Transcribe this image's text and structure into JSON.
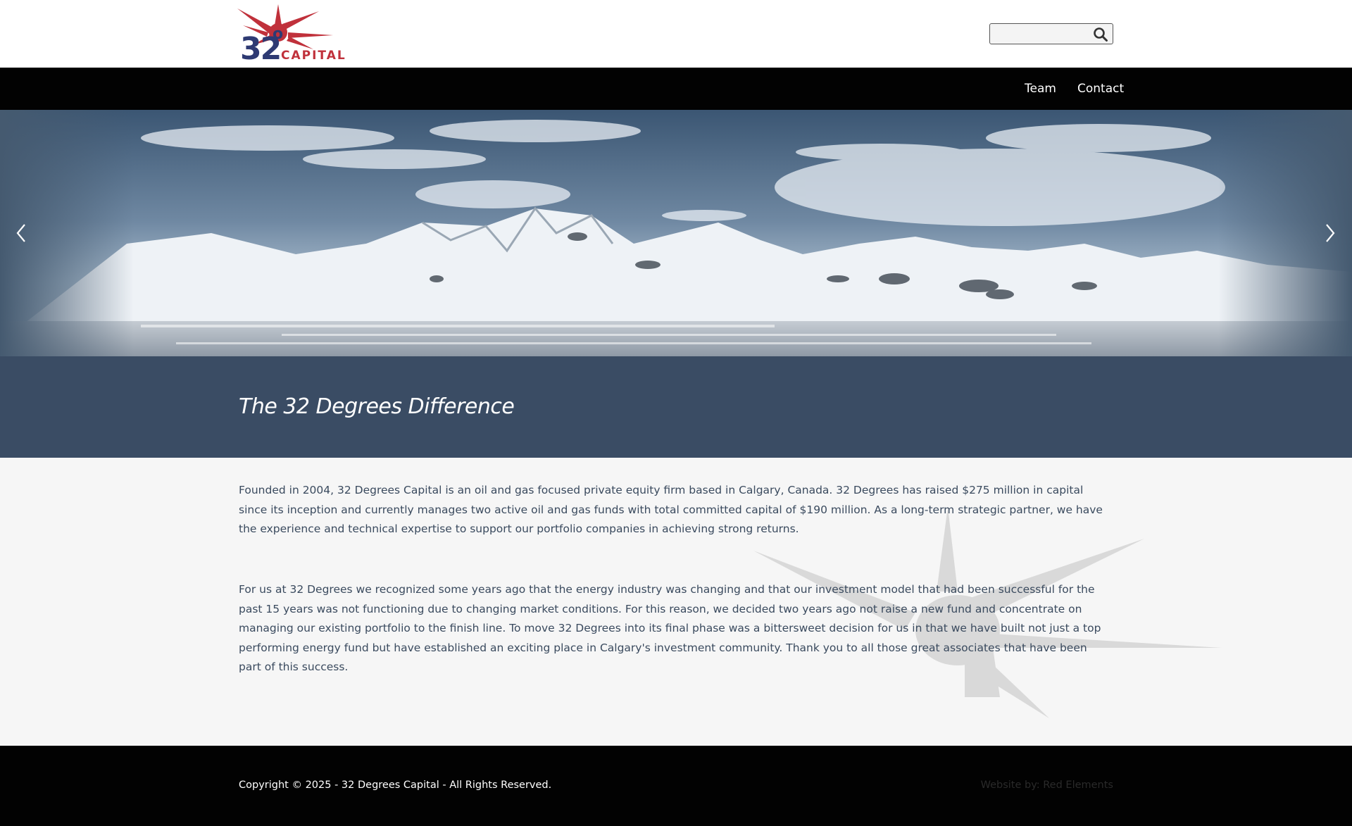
{
  "brand": {
    "logo_number": "32",
    "logo_degree": "o",
    "logo_word": "CAPITAL",
    "colors": {
      "navy": "#2e3a73",
      "red": "#c0313b"
    }
  },
  "search": {
    "placeholder": "",
    "value": "",
    "icon": "search-icon"
  },
  "nav": {
    "items": [
      {
        "label": "Team"
      },
      {
        "label": "Contact"
      }
    ]
  },
  "hero": {
    "prev_icon": "chevron-left-icon",
    "next_icon": "chevron-right-icon"
  },
  "section": {
    "title": "The 32 Degrees Difference"
  },
  "content": {
    "paragraphs": [
      "Founded in 2004, 32 Degrees Capital is an oil and gas focused private equity firm based in Calgary, Canada. 32 Degrees has raised $275 million in capital since its inception and currently manages two active oil and gas funds with total committed capital of $190 million. As a long-term strategic partner, we have the experience and technical expertise to support our portfolio companies in achieving strong returns.",
      "For us at 32 Degrees we recognized some years ago that the energy industry was changing and that our investment model that had been successful for the past 15 years was not functioning due to changing market conditions.  For this reason, we decided two years ago not raise a new fund and concentrate on managing our existing portfolio to the finish line. To move 32 Degrees into its final phase was a bittersweet decision for us in that we have built not just a top performing energy fund but have established an exciting place in Calgary's investment community.  Thank you to all those great associates that have been part of this success."
    ]
  },
  "footer": {
    "copyright": "Copyright © 2025 - 32 Degrees Capital - All Rights Reserved.",
    "credit": "Website by: Red Elements"
  },
  "colors": {
    "nav_bg": "#020202",
    "band_bg": "#3a4c64",
    "content_bg": "#f6f6f6",
    "text": "#3a4a5e"
  }
}
